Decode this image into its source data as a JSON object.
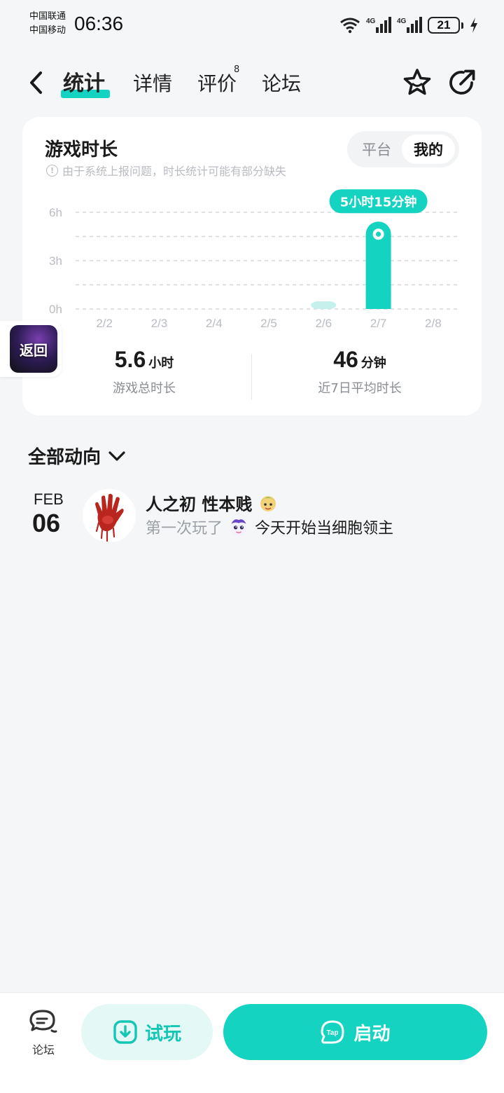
{
  "status": {
    "carrier1": "中国联通",
    "carrier2": "中国移动",
    "time": "06:36",
    "net1": "4G",
    "net2": "4G",
    "battery": "21"
  },
  "header": {
    "tabs": [
      {
        "label": "统计",
        "active": true
      },
      {
        "label": "详情",
        "active": false
      },
      {
        "label": "评价",
        "active": false,
        "badge": "8"
      },
      {
        "label": "论坛",
        "active": false
      }
    ],
    "icons": [
      "back-icon",
      "star-icon",
      "share-icon"
    ]
  },
  "stats": {
    "title": "游戏时长",
    "note": "由于系统上报问题，时长统计可能有部分缺失",
    "segment": {
      "options": [
        "平台",
        "我的"
      ],
      "selected": "我的"
    },
    "total": {
      "value": "5.6",
      "unit": "小时",
      "label": "游戏总时长"
    },
    "average": {
      "value": "46",
      "unit": "分钟",
      "label": "近7日平均时长"
    },
    "tooltip": "5小时15分钟"
  },
  "chart_data": {
    "type": "bar",
    "categories": [
      "2/2",
      "2/3",
      "2/4",
      "2/5",
      "2/6",
      "2/7",
      "2/8"
    ],
    "values": [
      0,
      0,
      0,
      0,
      0.3,
      5.25,
      0
    ],
    "y_tick_labels": [
      "0h",
      "3h",
      "6h"
    ],
    "y_ticks": [
      0,
      3,
      6
    ],
    "ylim": [
      0,
      6
    ],
    "grid": true,
    "highlight_index": 5,
    "colors": {
      "bar": "#14d3c0",
      "bar_faint": "#c4f1ec",
      "grid": "#d6d9dd",
      "tick": "#b8bcc2"
    }
  },
  "floating": {
    "label": "返回"
  },
  "feed": {
    "filter": "全部动向",
    "items": [
      {
        "month": "FEB",
        "day": "06",
        "user": "人之初 性本贱",
        "action": "第一次玩了",
        "game": "今天开始当细胞领主"
      }
    ]
  },
  "bottom": {
    "forum": "论坛",
    "trial": "试玩",
    "launch": "启动",
    "tap_logo": "Tap"
  },
  "colors": {
    "accent": "#14d3c0",
    "accent_soft": "#e4f8f6",
    "background": "#f5f6f8"
  }
}
